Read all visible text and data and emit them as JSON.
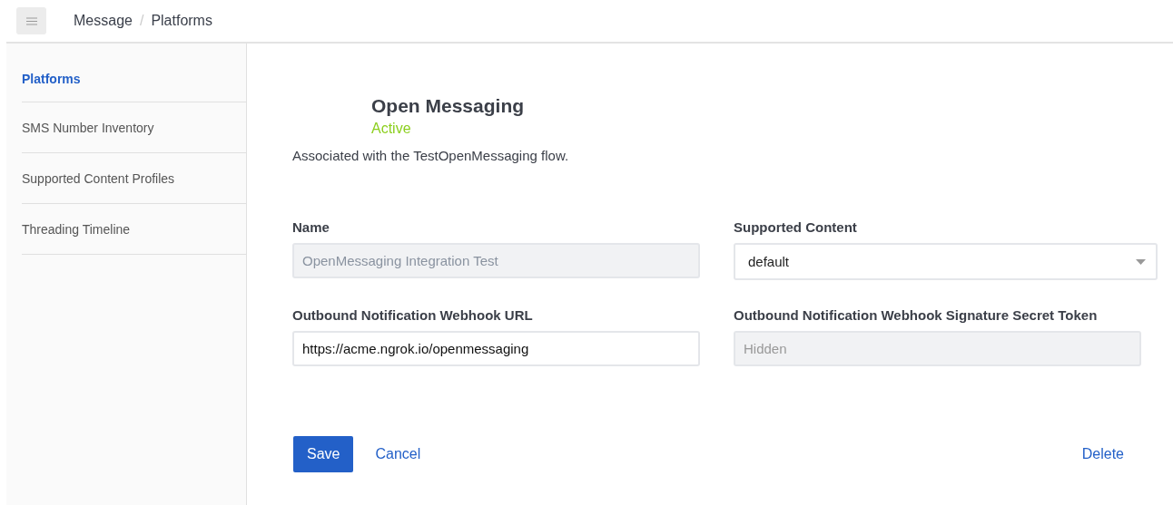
{
  "breadcrumb": {
    "items": [
      "Message",
      "Platforms"
    ],
    "separator": "/"
  },
  "sidebar": {
    "items": [
      {
        "label": "Platforms",
        "selected": true
      },
      {
        "label": "SMS Number Inventory",
        "selected": false
      },
      {
        "label": "Supported Content Profiles",
        "selected": false
      },
      {
        "label": "Threading Timeline",
        "selected": false
      }
    ]
  },
  "platform": {
    "title": "Open Messaging",
    "status": "Active",
    "description": "Associated with the TestOpenMessaging flow."
  },
  "fields": [
    {
      "kind": "text",
      "label": "Name",
      "value": "OpenMessaging Integration Test",
      "disabled": true
    },
    {
      "kind": "select",
      "label": "Supported Content",
      "value": "default"
    },
    {
      "kind": "text",
      "label": "Outbound Notification Webhook URL",
      "value": "https://acme.ngrok.io/openmessaging",
      "disabled": false
    },
    {
      "kind": "text",
      "label": "Outbound Notification Webhook Signature Secret Token",
      "placeholder": "Hidden",
      "disabled": true
    }
  ],
  "actions": {
    "save": "Save",
    "cancel": "Cancel",
    "delete": "Delete"
  }
}
